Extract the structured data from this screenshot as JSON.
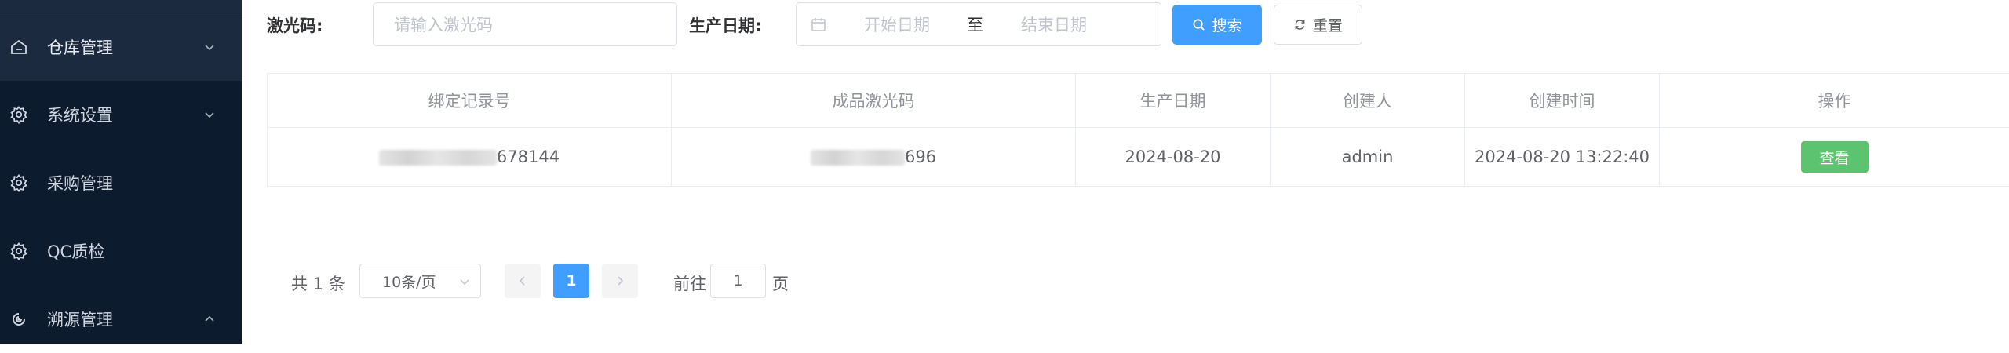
{
  "sidebar": {
    "items": [
      {
        "label": "仓库管理",
        "icon": "home-icon",
        "arrow": "chevron-down-icon"
      },
      {
        "label": "系统设置",
        "icon": "gear-icon",
        "arrow": "chevron-down-icon"
      },
      {
        "label": "采购管理",
        "icon": "gear-icon"
      },
      {
        "label": "QC质检",
        "icon": "gear-icon"
      },
      {
        "label": "溯源管理",
        "icon": "target-icon",
        "arrow": "chevron-up-icon"
      }
    ]
  },
  "search": {
    "laser_label": "激光码:",
    "laser_placeholder": "请输入激光码",
    "date_label": "生产日期:",
    "start_placeholder": "开始日期",
    "date_separator": "至",
    "end_placeholder": "结束日期",
    "search_button": "搜索",
    "reset_button": "重置"
  },
  "table": {
    "columns": [
      "绑定记录号",
      "成品激光码",
      "生产日期",
      "创建人",
      "创建时间",
      "操作"
    ],
    "rows": [
      {
        "record_no_visible": "678144",
        "laser_code_visible": "696",
        "production_date": "2024-08-20",
        "creator": "admin",
        "created_at": "2024-08-20 13:22:40",
        "action": "查看"
      }
    ]
  },
  "pagination": {
    "total": "共 1 条",
    "page_size": "10条/页",
    "current_page": "1",
    "goto_prefix": "前往",
    "goto_value": "1",
    "goto_suffix": "页"
  },
  "colors": {
    "sidebar_bg": "#0d1b2e",
    "primary": "#409eff",
    "success": "#5cc46f"
  }
}
